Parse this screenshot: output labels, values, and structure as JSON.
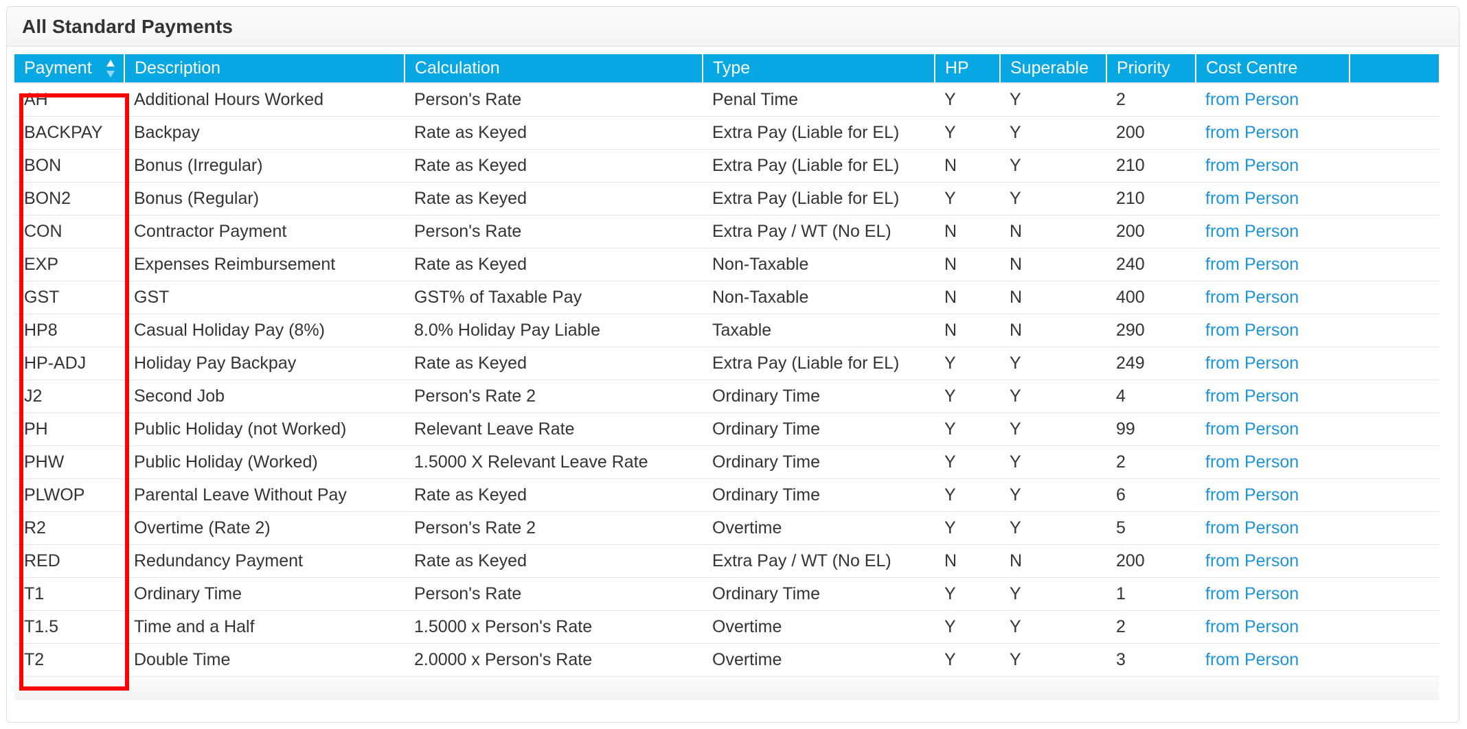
{
  "panel": {
    "title": "All Standard Payments"
  },
  "table": {
    "columns": [
      {
        "key": "payment",
        "label": "Payment",
        "sortable": true,
        "sort_icon": "sort-both-icon"
      },
      {
        "key": "desc",
        "label": "Description",
        "sortable": false
      },
      {
        "key": "calc",
        "label": "Calculation",
        "sortable": false
      },
      {
        "key": "type",
        "label": "Type",
        "sortable": false
      },
      {
        "key": "hp",
        "label": "HP",
        "sortable": false
      },
      {
        "key": "super",
        "label": "Superable",
        "sortable": false
      },
      {
        "key": "priority",
        "label": "Priority",
        "sortable": false
      },
      {
        "key": "cost",
        "label": "Cost Centre",
        "sortable": false
      },
      {
        "key": "blank",
        "label": "",
        "sortable": false
      }
    ],
    "rows": [
      {
        "payment": "AH",
        "desc": "Additional Hours Worked",
        "calc": "Person's Rate",
        "type": "Penal Time",
        "hp": "Y",
        "super": "Y",
        "priority": "2",
        "cost": "from Person"
      },
      {
        "payment": "BACKPAY",
        "desc": "Backpay",
        "calc": "Rate as Keyed",
        "type": "Extra Pay (Liable for EL)",
        "hp": "Y",
        "super": "Y",
        "priority": "200",
        "cost": "from Person"
      },
      {
        "payment": "BON",
        "desc": "Bonus (Irregular)",
        "calc": "Rate as Keyed",
        "type": "Extra Pay (Liable for EL)",
        "hp": "N",
        "super": "Y",
        "priority": "210",
        "cost": "from Person"
      },
      {
        "payment": "BON2",
        "desc": "Bonus (Regular)",
        "calc": "Rate as Keyed",
        "type": "Extra Pay (Liable for EL)",
        "hp": "Y",
        "super": "Y",
        "priority": "210",
        "cost": "from Person"
      },
      {
        "payment": "CON",
        "desc": "Contractor Payment",
        "calc": "Person's Rate",
        "type": "Extra Pay / WT (No EL)",
        "hp": "N",
        "super": "N",
        "priority": "200",
        "cost": "from Person"
      },
      {
        "payment": "EXP",
        "desc": "Expenses Reimbursement",
        "calc": "Rate as Keyed",
        "type": "Non-Taxable",
        "hp": "N",
        "super": "N",
        "priority": "240",
        "cost": "from Person"
      },
      {
        "payment": "GST",
        "desc": "GST",
        "calc": "GST% of Taxable Pay",
        "type": "Non-Taxable",
        "hp": "N",
        "super": "N",
        "priority": "400",
        "cost": "from Person"
      },
      {
        "payment": "HP8",
        "desc": "Casual Holiday Pay (8%)",
        "calc": "8.0% Holiday Pay Liable",
        "type": "Taxable",
        "hp": "N",
        "super": "N",
        "priority": "290",
        "cost": "from Person"
      },
      {
        "payment": "HP-ADJ",
        "desc": "Holiday Pay Backpay",
        "calc": "Rate as Keyed",
        "type": "Extra Pay (Liable for EL)",
        "hp": "Y",
        "super": "Y",
        "priority": "249",
        "cost": "from Person"
      },
      {
        "payment": "J2",
        "desc": "Second Job",
        "calc": "Person's Rate 2",
        "type": "Ordinary Time",
        "hp": "Y",
        "super": "Y",
        "priority": "4",
        "cost": "from Person"
      },
      {
        "payment": "PH",
        "desc": "Public Holiday (not Worked)",
        "calc": "Relevant Leave Rate",
        "type": "Ordinary Time",
        "hp": "Y",
        "super": "Y",
        "priority": "99",
        "cost": "from Person"
      },
      {
        "payment": "PHW",
        "desc": "Public Holiday (Worked)",
        "calc": "1.5000 X Relevant Leave Rate",
        "type": "Ordinary Time",
        "hp": "Y",
        "super": "Y",
        "priority": "2",
        "cost": "from Person"
      },
      {
        "payment": "PLWOP",
        "desc": "Parental Leave Without Pay",
        "calc": "Rate as Keyed",
        "type": "Ordinary Time",
        "hp": "Y",
        "super": "Y",
        "priority": "6",
        "cost": "from Person"
      },
      {
        "payment": "R2",
        "desc": "Overtime (Rate 2)",
        "calc": "Person's Rate 2",
        "type": "Overtime",
        "hp": "Y",
        "super": "Y",
        "priority": "5",
        "cost": "from Person"
      },
      {
        "payment": "RED",
        "desc": "Redundancy Payment",
        "calc": "Rate as Keyed",
        "type": "Extra Pay / WT (No EL)",
        "hp": "N",
        "super": "N",
        "priority": "200",
        "cost": "from Person"
      },
      {
        "payment": "T1",
        "desc": "Ordinary Time",
        "calc": "Person's Rate",
        "type": "Ordinary Time",
        "hp": "Y",
        "super": "Y",
        "priority": "1",
        "cost": "from Person"
      },
      {
        "payment": "T1.5",
        "desc": "Time and a Half",
        "calc": "1.5000 x Person's Rate",
        "type": "Overtime",
        "hp": "Y",
        "super": "Y",
        "priority": "2",
        "cost": "from Person"
      },
      {
        "payment": "T2",
        "desc": "Double Time",
        "calc": "2.0000 x Person's Rate",
        "type": "Overtime",
        "hp": "Y",
        "super": "Y",
        "priority": "3",
        "cost": "from Person"
      }
    ]
  },
  "annotation": {
    "shape": "rectangle",
    "color": "#FF0000",
    "target_column": "Payment"
  },
  "colors": {
    "header_blue": "#06A7E2",
    "link_blue": "#1C94DA",
    "text": "#333333",
    "row_border": "#e4e4e4",
    "panel_border": "#dddddd",
    "annotation_red": "#FF0000"
  }
}
